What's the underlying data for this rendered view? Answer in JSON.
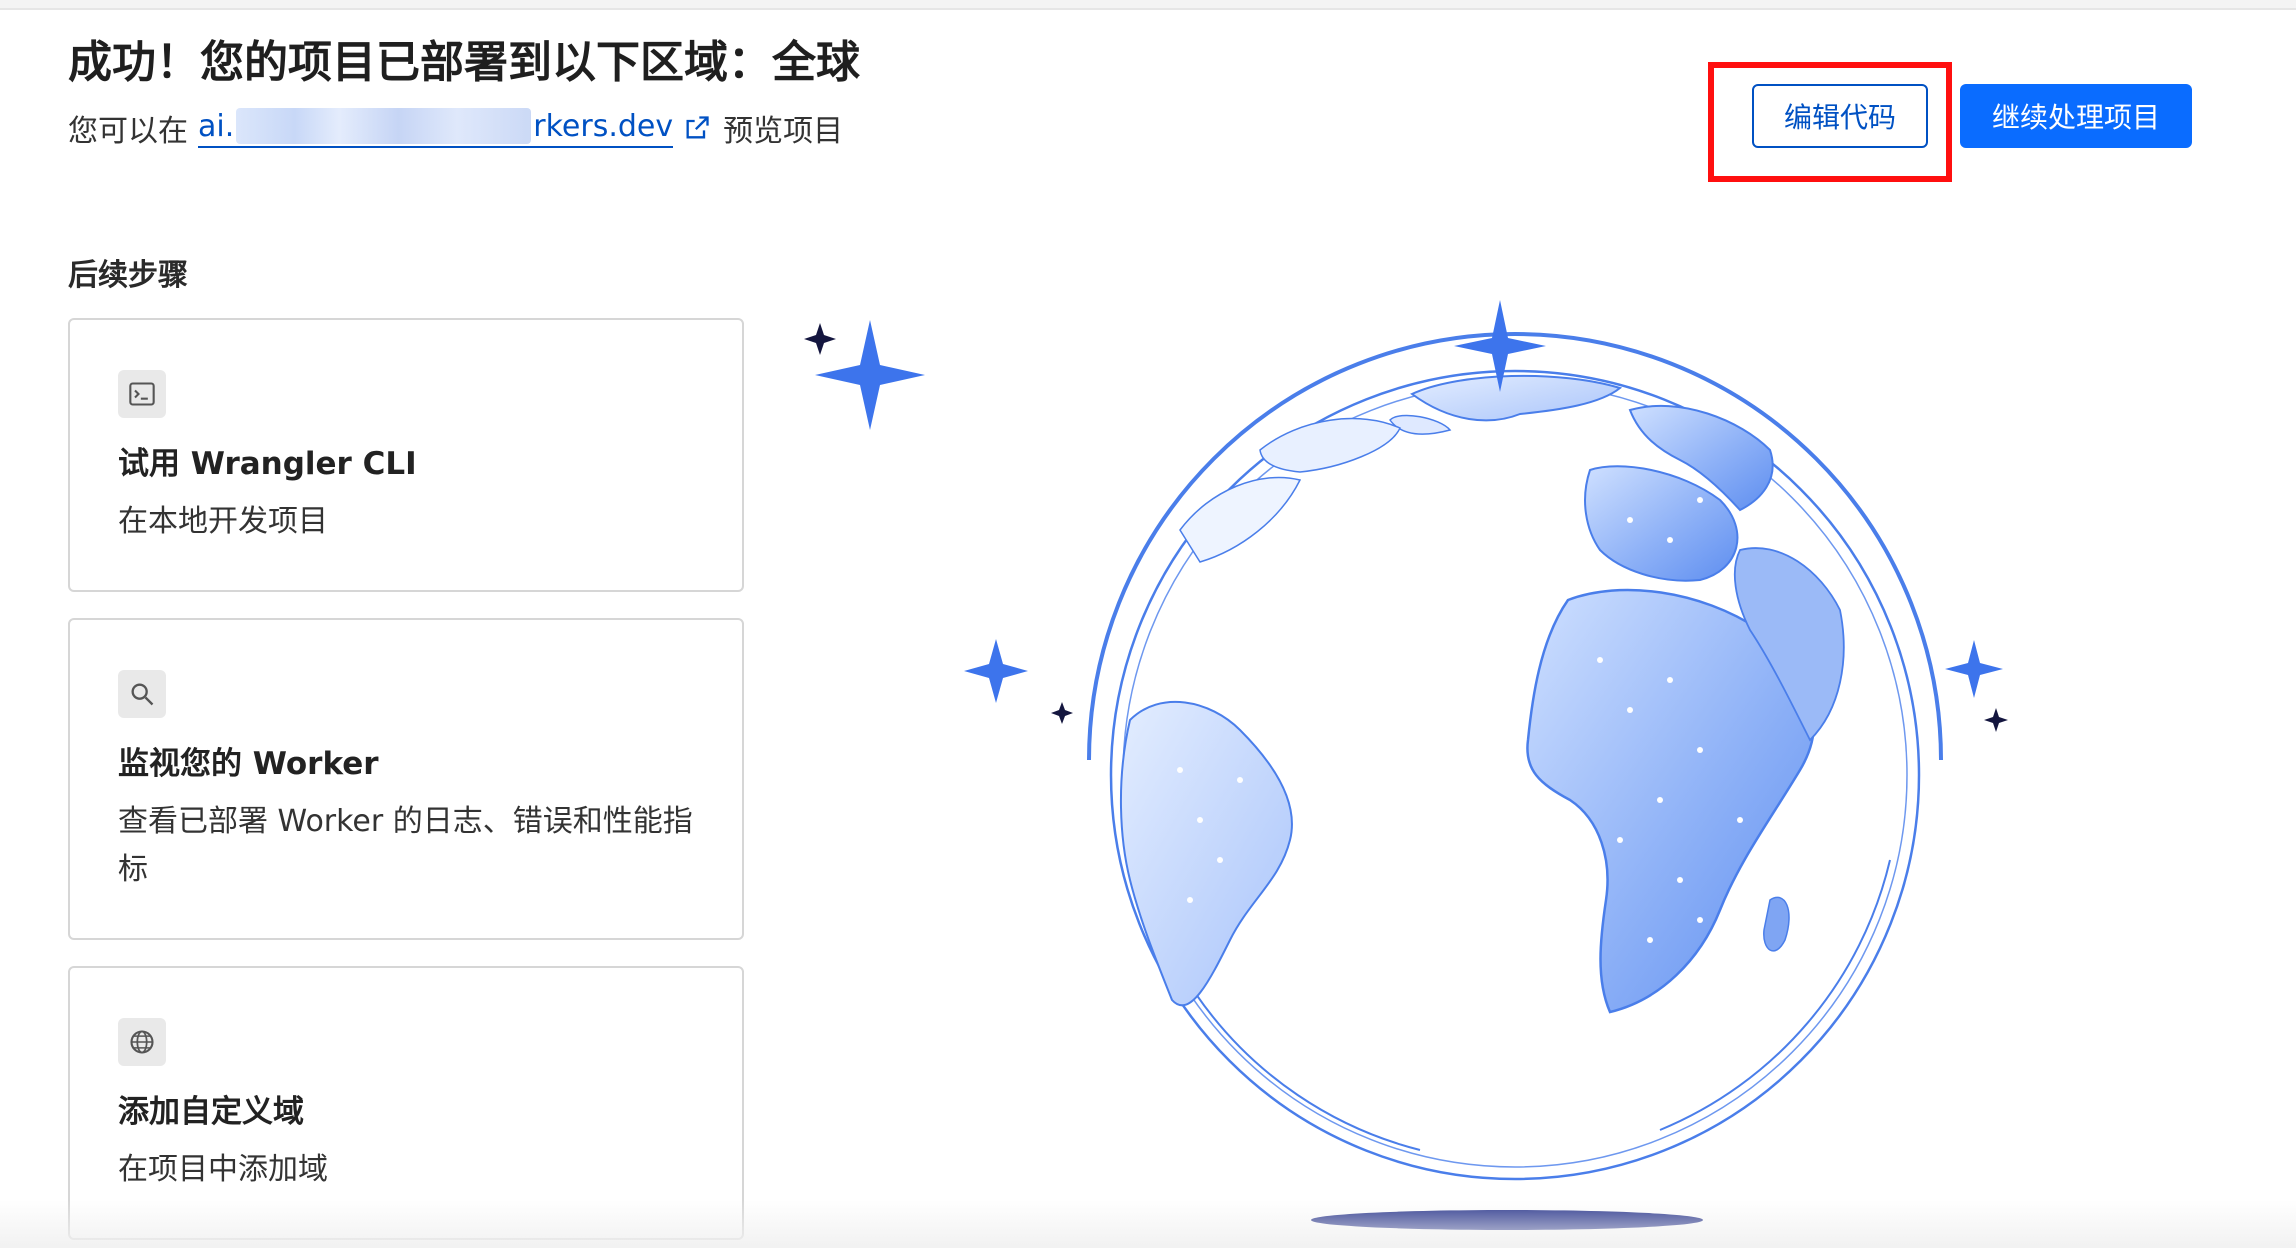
{
  "header": {
    "title": "成功！您的项目已部署到以下区域：全球",
    "subtitle_prefix": "您可以在",
    "link_start": "ai.",
    "link_end": "rkers.dev",
    "subtitle_suffix": "预览项目"
  },
  "actions": {
    "edit_code": "编辑代码",
    "continue": "继续处理项目"
  },
  "next_steps": {
    "heading": "后续步骤",
    "cards": [
      {
        "title": "试用 Wrangler CLI",
        "description": "在本地开发项目",
        "icon": "terminal-icon"
      },
      {
        "title": "监视您的 Worker",
        "description": "查看已部署 Worker 的日志、错误和性能指标",
        "icon": "search-icon"
      },
      {
        "title": "添加自定义域",
        "description": "在项目中添加域",
        "icon": "globe-icon"
      }
    ]
  },
  "colors": {
    "primary": "#0a6cff",
    "link": "#0051c3",
    "highlight": "#ff0f0f",
    "globe": "#5a8ef0"
  }
}
